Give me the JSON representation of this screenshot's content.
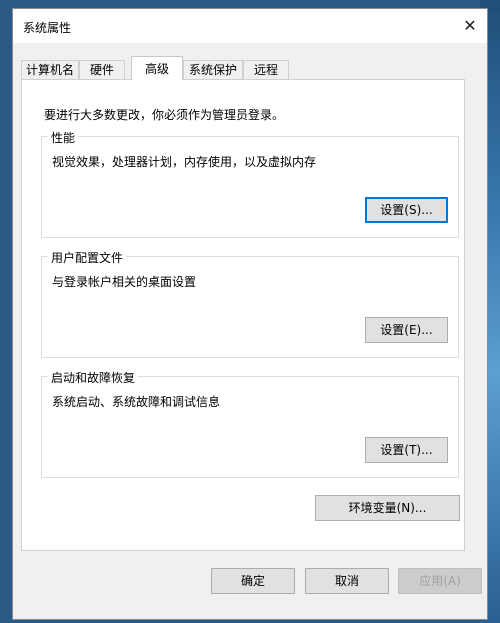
{
  "window": {
    "title": "系统属性",
    "close_glyph": "✕"
  },
  "tabs": [
    {
      "label": "计算机名"
    },
    {
      "label": "硬件"
    },
    {
      "label": "高级",
      "active": true
    },
    {
      "label": "系统保护"
    },
    {
      "label": "远程"
    }
  ],
  "admin_note": "要进行大多数更改，你必须作为管理员登录。",
  "performance": {
    "title": "性能",
    "description": "视觉效果，处理器计划，内存使用，以及虚拟内存",
    "settings_label": "设置(S)..."
  },
  "user_profiles": {
    "title": "用户配置文件",
    "description": "与登录帐户相关的桌面设置",
    "settings_label": "设置(E)..."
  },
  "startup_recovery": {
    "title": "启动和故障恢复",
    "description": "系统启动、系统故障和调试信息",
    "settings_label": "设置(T)..."
  },
  "env_vars_label": "环境变量(N)...",
  "footer": {
    "ok_label": "确定",
    "cancel_label": "取消",
    "apply_label": "应用(A)"
  },
  "colors": {
    "accent": "#0078d7",
    "dialog_bg": "#f0f0f0",
    "panel_bg": "#ffffff"
  }
}
